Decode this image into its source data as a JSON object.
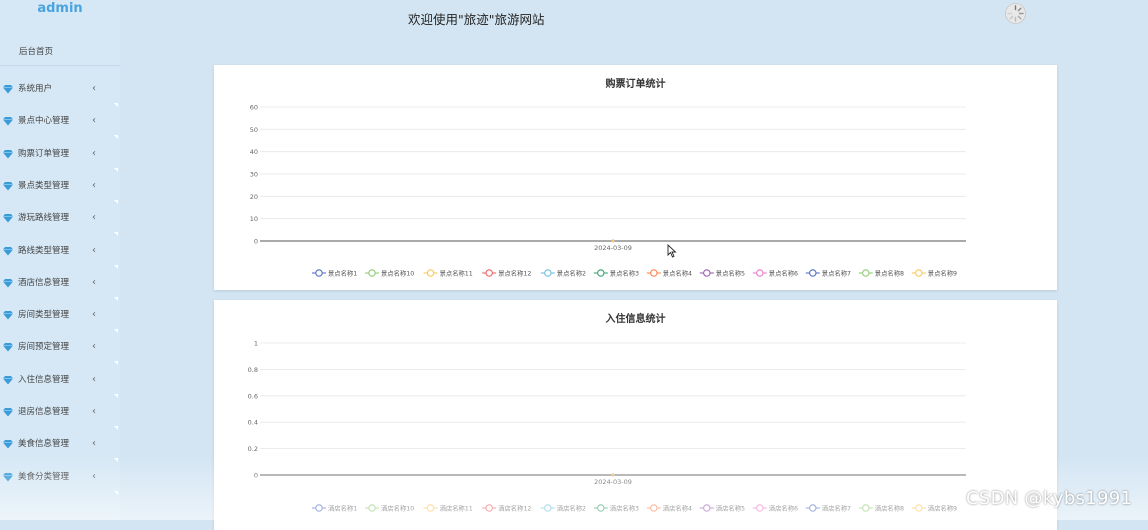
{
  "sidebar": {
    "brand": "admin",
    "home": "后台首页",
    "items": [
      {
        "label": "系统用户"
      },
      {
        "label": "景点中心管理"
      },
      {
        "label": "购票订单管理"
      },
      {
        "label": "景点类型管理"
      },
      {
        "label": "游玩路线管理"
      },
      {
        "label": "路线类型管理"
      },
      {
        "label": "酒店信息管理"
      },
      {
        "label": "房间类型管理"
      },
      {
        "label": "房间预定管理"
      },
      {
        "label": "入住信息管理"
      },
      {
        "label": "退房信息管理"
      },
      {
        "label": "美食信息管理"
      },
      {
        "label": "美食分类管理"
      }
    ],
    "chevron": "‹"
  },
  "header": {
    "welcome": "欢迎使用\"旅迹\"旅游网站"
  },
  "watermark": "CSDN @kybs1991",
  "colors": {
    "background": "#d3e5f3",
    "sidebar": "#d6e8f5",
    "brand": "#4aa3de",
    "gem": "#3a9bd8"
  },
  "chart_data": [
    {
      "type": "line",
      "title": "购票订单统计",
      "categories": [
        "2024-03-09"
      ],
      "yticks": [
        "0",
        "10",
        "20",
        "30",
        "40",
        "50",
        "60"
      ],
      "ylim": [
        0,
        60
      ],
      "grid": true,
      "legend_position": "bottom",
      "series": [
        {
          "name": "景点名称1",
          "values": [
            0
          ],
          "color": "#5470c6"
        },
        {
          "name": "景点名称10",
          "values": [
            0
          ],
          "color": "#91cc75"
        },
        {
          "name": "景点名称11",
          "values": [
            0
          ],
          "color": "#fac858"
        },
        {
          "name": "景点名称12",
          "values": [
            0
          ],
          "color": "#ee6666"
        },
        {
          "name": "景点名称2",
          "values": [
            0
          ],
          "color": "#73c0de"
        },
        {
          "name": "景点名称3",
          "values": [
            0
          ],
          "color": "#3ba272"
        },
        {
          "name": "景点名称4",
          "values": [
            0
          ],
          "color": "#fc8452"
        },
        {
          "name": "景点名称5",
          "values": [
            0
          ],
          "color": "#9a60b4"
        },
        {
          "name": "景点名称6",
          "values": [
            0
          ],
          "color": "#ea7ccc"
        },
        {
          "name": "景点名称7",
          "values": [
            0
          ],
          "color": "#5470c6"
        },
        {
          "name": "景点名称8",
          "values": [
            0
          ],
          "color": "#91cc75"
        },
        {
          "name": "景点名称9",
          "values": [
            0
          ],
          "color": "#fac858"
        }
      ]
    },
    {
      "type": "line",
      "title": "入住信息统计",
      "categories": [
        "2024-03-09"
      ],
      "yticks": [
        "0",
        "0.2",
        "0.4",
        "0.6",
        "0.8",
        "1"
      ],
      "ylim": [
        0,
        1
      ],
      "grid": true,
      "legend_position": "bottom",
      "series": [
        {
          "name": "酒店名称1",
          "values": [
            0
          ],
          "color": "#5470c6"
        },
        {
          "name": "酒店名称10",
          "values": [
            0
          ],
          "color": "#91cc75"
        },
        {
          "name": "酒店名称11",
          "values": [
            0
          ],
          "color": "#fac858"
        },
        {
          "name": "酒店名称12",
          "values": [
            0
          ],
          "color": "#ee6666"
        },
        {
          "name": "酒店名称2",
          "values": [
            0
          ],
          "color": "#73c0de"
        },
        {
          "name": "酒店名称3",
          "values": [
            0
          ],
          "color": "#3ba272"
        },
        {
          "name": "酒店名称4",
          "values": [
            0
          ],
          "color": "#fc8452"
        },
        {
          "name": "酒店名称5",
          "values": [
            0
          ],
          "color": "#9a60b4"
        },
        {
          "name": "酒店名称6",
          "values": [
            0
          ],
          "color": "#ea7ccc"
        },
        {
          "name": "酒店名称7",
          "values": [
            0
          ],
          "color": "#5470c6"
        },
        {
          "name": "酒店名称8",
          "values": [
            0
          ],
          "color": "#91cc75"
        },
        {
          "name": "酒店名称9",
          "values": [
            0
          ],
          "color": "#fac858"
        }
      ]
    }
  ]
}
